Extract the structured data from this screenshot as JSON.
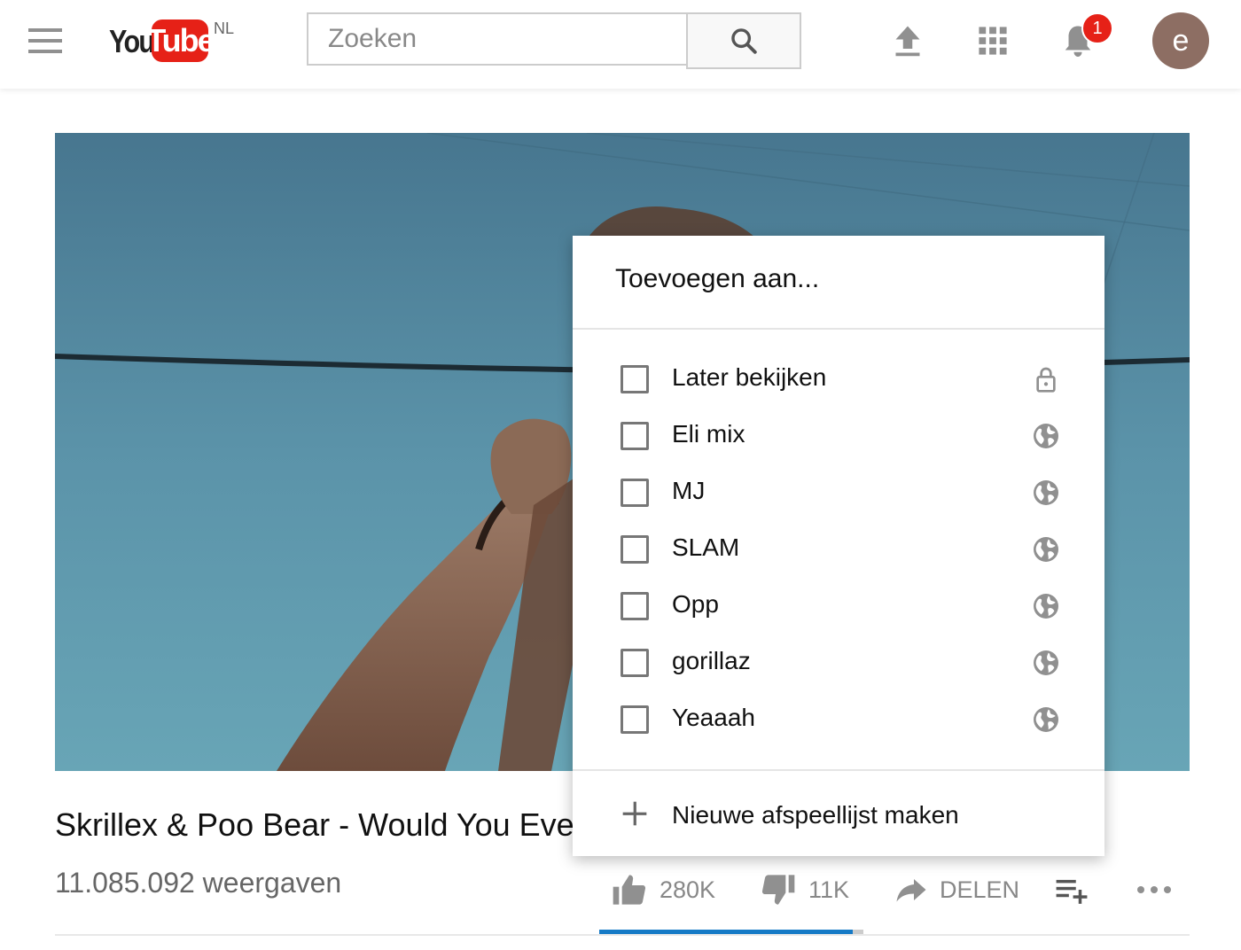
{
  "header": {
    "logo_you": "You",
    "logo_tube": "Tube",
    "region": "NL",
    "search_placeholder": "Zoeken",
    "notification_count": "1",
    "avatar_letter": "e"
  },
  "video": {
    "title": "Skrillex & Poo Bear - Would You Ever",
    "views": "11.085.092 weergaven",
    "likes": "280K",
    "dislikes": "11K",
    "share_label": "DELEN",
    "like_ratio": 0.96
  },
  "dialog": {
    "title": "Toevoegen aan...",
    "playlists": [
      {
        "name": "Later bekijken",
        "privacy_icon": "lock-icon",
        "checked": false
      },
      {
        "name": "Eli mix",
        "privacy_icon": "globe-icon",
        "checked": false
      },
      {
        "name": "MJ",
        "privacy_icon": "globe-icon",
        "checked": false
      },
      {
        "name": "SLAM",
        "privacy_icon": "globe-icon",
        "checked": false
      },
      {
        "name": "Opp",
        "privacy_icon": "globe-icon",
        "checked": false
      },
      {
        "name": "gorillaz",
        "privacy_icon": "globe-icon",
        "checked": false
      },
      {
        "name": "Yeaaah",
        "privacy_icon": "globe-icon",
        "checked": false
      }
    ],
    "new_playlist_label": "Nieuwe afspeellijst maken"
  },
  "colors": {
    "brand_red": "#e62117",
    "accent_blue": "#167ac6",
    "avatar_bg": "#8d6e63"
  }
}
